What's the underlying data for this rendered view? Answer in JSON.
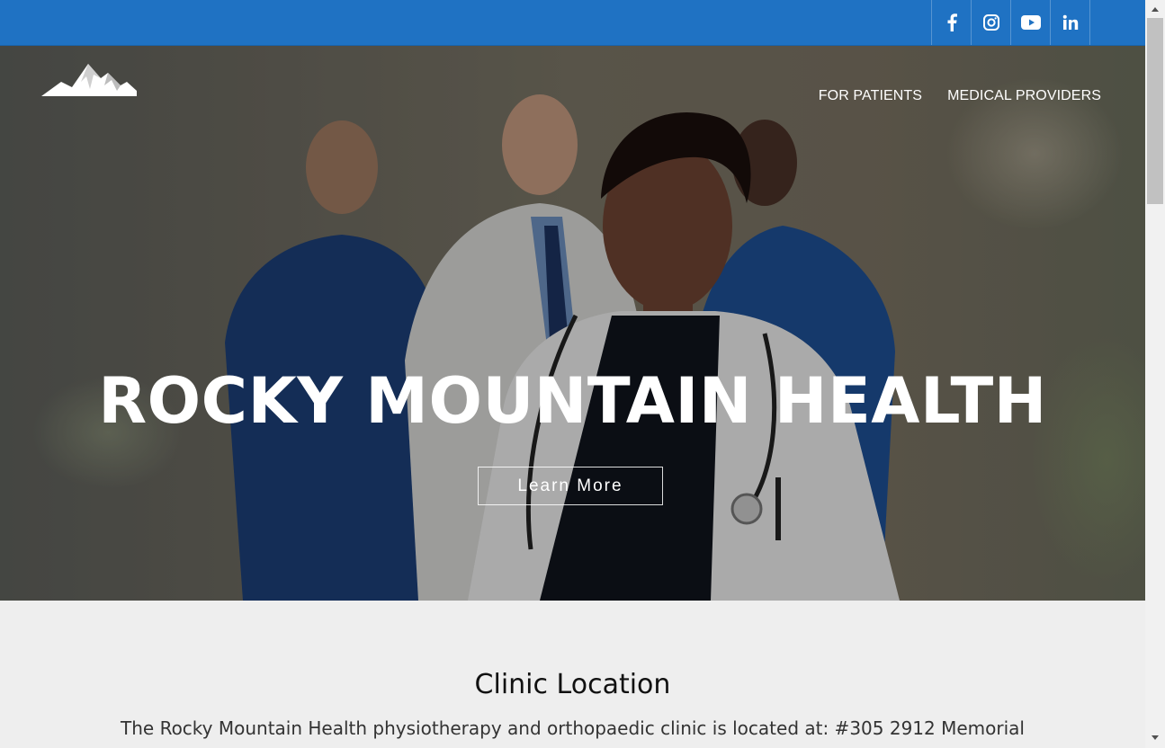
{
  "topbar": {
    "color": "#1f72c3",
    "social": [
      {
        "name": "facebook",
        "icon": "facebook-icon"
      },
      {
        "name": "instagram",
        "icon": "instagram-icon"
      },
      {
        "name": "youtube",
        "icon": "youtube-icon"
      },
      {
        "name": "linkedin",
        "icon": "linkedin-icon"
      }
    ]
  },
  "header": {
    "logo_icon": "mountain-logo-icon",
    "nav": {
      "patients": "FOR PATIENTS",
      "providers": "MEDICAL PROVIDERS"
    }
  },
  "hero": {
    "title": "ROCKY MOUNTAIN HEALTH",
    "cta_label": "Learn More"
  },
  "clinic": {
    "title": "Clinic Location",
    "text": "The Rocky Mountain Health physiotherapy and orthopaedic clinic is located at: #305 2912 Memorial"
  }
}
